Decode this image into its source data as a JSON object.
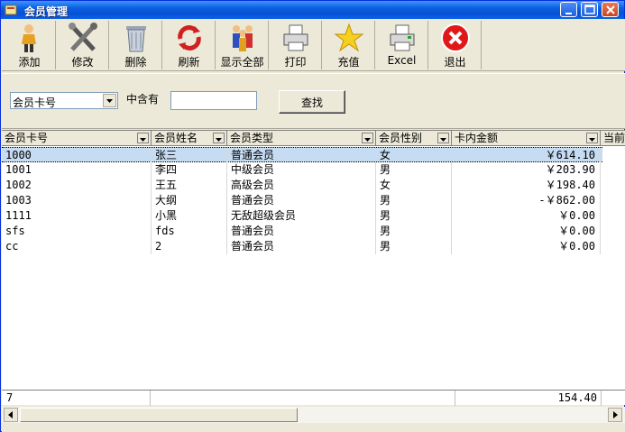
{
  "window": {
    "title": "会员管理"
  },
  "toolbar": {
    "buttons": [
      {
        "label": "添加",
        "icon": "person-add-icon"
      },
      {
        "label": "修改",
        "icon": "tools-icon"
      },
      {
        "label": "删除",
        "icon": "trash-icon"
      },
      {
        "label": "刷新",
        "icon": "refresh-icon"
      },
      {
        "label": "显示全部",
        "icon": "people-group-icon"
      },
      {
        "label": "打印",
        "icon": "printer-icon"
      },
      {
        "label": "充值",
        "icon": "star-icon"
      },
      {
        "label": "Excel",
        "icon": "excel-printer-icon"
      },
      {
        "label": "退出",
        "icon": "exit-icon"
      }
    ]
  },
  "search": {
    "field_selected": "会员卡号",
    "contains_label": "中含有",
    "query_value": "",
    "find_label": "查找"
  },
  "grid": {
    "columns": [
      "会员卡号",
      "会员姓名",
      "会员类型",
      "会员性别",
      "卡内金额",
      "当前"
    ],
    "rows": [
      [
        "1000",
        "张三",
        "普通会员",
        "女",
        "￥614.10"
      ],
      [
        "1001",
        "李四",
        "中级会员",
        "男",
        "￥203.90"
      ],
      [
        "1002",
        "王五",
        "高级会员",
        "女",
        "￥198.40"
      ],
      [
        "1003",
        "大纲",
        "普通会员",
        "男",
        "-￥862.00"
      ],
      [
        "1111",
        "小黑",
        "无敌超级会员",
        "男",
        "￥0.00"
      ],
      [
        "sfs",
        "fds",
        "普通会员",
        "男",
        "￥0.00"
      ],
      [
        "cc",
        "2",
        "普通会员",
        "男",
        "￥0.00"
      ]
    ]
  },
  "footer": {
    "count": "7",
    "total": "154.40"
  },
  "colors": {
    "selection": "#c5dcf3",
    "titlebar": "#0a5fe0",
    "exit_red": "#e01818"
  }
}
